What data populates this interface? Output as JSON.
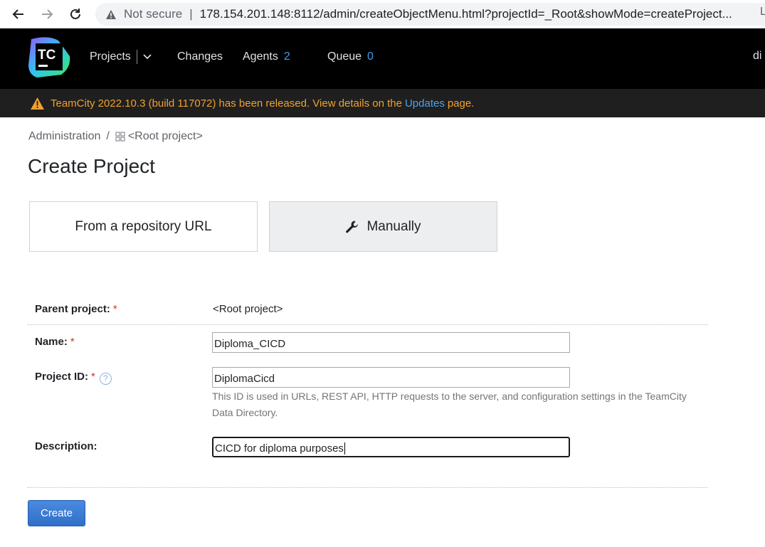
{
  "browser": {
    "back_icon": "arrow-left-icon",
    "forward_icon": "arrow-right-icon",
    "reload_icon": "reload-icon",
    "security_icon": "warning-triangle-icon",
    "not_secure": "Not secure",
    "separator": "|",
    "url": "178.154.201.148:8112/admin/createObjectMenu.html?projectId=_Root&showMode=createProject...",
    "url_tail": "L"
  },
  "header": {
    "logo_text": "TC",
    "nav": {
      "projects": "Projects",
      "changes": "Changes",
      "agents": "Agents",
      "agents_count": "2",
      "queue": "Queue",
      "queue_count": "0"
    },
    "user_tail": "di"
  },
  "banner": {
    "text_before": "TeamCity 2022.10.3 (build 117072) has been released. View details on the",
    "link": "Updates",
    "text_after": "page."
  },
  "breadcrumb": {
    "admin": "Administration",
    "slash": "/",
    "root": "<Root project>"
  },
  "page": {
    "title": "Create Project"
  },
  "modes": {
    "repo": "From a repository URL",
    "manual": "Manually"
  },
  "form": {
    "parent_label": "Parent project:",
    "parent_value": "<Root project>",
    "name_label": "Name:",
    "name_value": "Diploma_CICD",
    "id_label": "Project ID:",
    "id_value": "DiplomaCicd",
    "id_hint": "This ID is used in URLs, REST API, HTTP requests to the server, and configuration settings in the TeamCity Data Directory.",
    "desc_label": "Description:",
    "desc_value": "CICD for diploma purposes",
    "required_mark": "*",
    "help": "?"
  },
  "actions": {
    "create": "Create"
  },
  "colors": {
    "header_bg": "#000000",
    "banner_text": "#f0a030",
    "link": "#4aa3f0",
    "counter": "#3d9cf0",
    "primary_button": "#3d7fd6",
    "required": "#d0312d"
  }
}
